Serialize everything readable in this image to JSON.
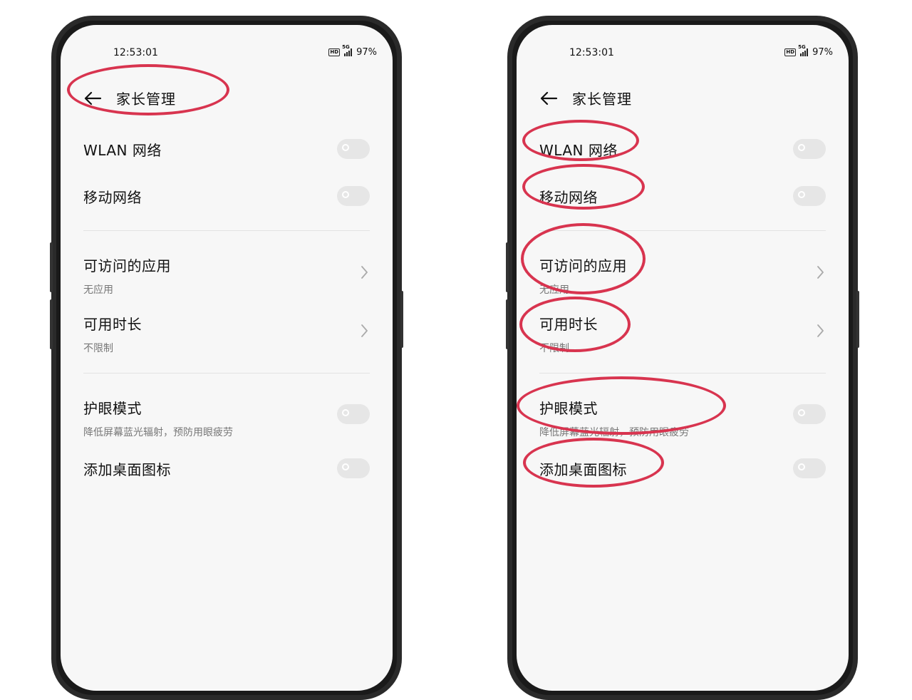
{
  "status_bar": {
    "time": "12:53:01",
    "hd_badge": "HD",
    "network_type": "5G",
    "battery": "97%"
  },
  "header": {
    "title": "家长管理",
    "back_icon": "arrow-left-icon"
  },
  "settings": {
    "wlan": {
      "label": "WLAN 网络",
      "enabled": false
    },
    "mobile": {
      "label": "移动网络",
      "enabled": false
    },
    "apps": {
      "label": "可访问的应用",
      "value": "无应用"
    },
    "time_limit": {
      "label": "可用时长",
      "value": "不限制"
    },
    "eye_care": {
      "label": "护眼模式",
      "description": "降低屏幕蓝光辐射，预防用眼疲劳",
      "enabled": false
    },
    "desktop_icon": {
      "label": "添加桌面图标",
      "enabled": false
    }
  },
  "annotation_color": "#d8344f"
}
